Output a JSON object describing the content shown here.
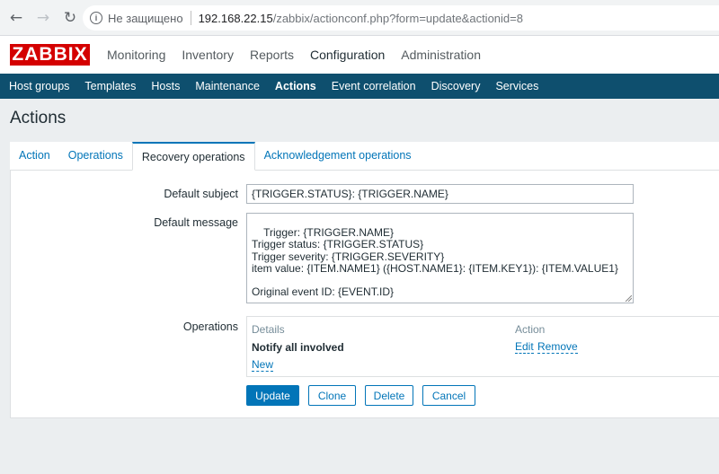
{
  "browser": {
    "back_icon": "←",
    "forward_icon": "→",
    "reload_icon": "↻",
    "info_icon": "i",
    "security_text": "Не защищено",
    "url_host": "192.168.22.15",
    "url_path": "/zabbix/actionconf.php?form=update&actionid=8"
  },
  "logo": "ZABBIX",
  "main_menu": [
    {
      "label": "Monitoring"
    },
    {
      "label": "Inventory"
    },
    {
      "label": "Reports"
    },
    {
      "label": "Configuration"
    },
    {
      "label": "Administration"
    }
  ],
  "sub_menu": [
    {
      "label": "Host groups"
    },
    {
      "label": "Templates"
    },
    {
      "label": "Hosts"
    },
    {
      "label": "Maintenance"
    },
    {
      "label": "Actions"
    },
    {
      "label": "Event correlation"
    },
    {
      "label": "Discovery"
    },
    {
      "label": "Services"
    }
  ],
  "page_title": "Actions",
  "tabs": [
    {
      "label": "Action"
    },
    {
      "label": "Operations"
    },
    {
      "label": "Recovery operations"
    },
    {
      "label": "Acknowledgement operations"
    }
  ],
  "form": {
    "subject_label": "Default subject",
    "subject_value": "{TRIGGER.STATUS}: {TRIGGER.NAME}",
    "message_label": "Default message",
    "message_value": "Trigger: {TRIGGER.NAME}\nTrigger status: {TRIGGER.STATUS}\nTrigger severity: {TRIGGER.SEVERITY}\nitem value: {ITEM.NAME1} ({HOST.NAME1}: {ITEM.KEY1}): {ITEM.VALUE1}\n\nOriginal event ID: {EVENT.ID}",
    "operations_label": "Operations",
    "operations": {
      "details_header": "Details",
      "action_header": "Action",
      "row_detail": "Notify all involved",
      "edit_link": "Edit",
      "remove_link": "Remove",
      "new_link": "New"
    }
  },
  "buttons": {
    "update": "Update",
    "clone": "Clone",
    "delete": "Delete",
    "cancel": "Cancel"
  },
  "colors": {
    "brand_red": "#d40000",
    "nav_blue": "#0e4f6e",
    "link_blue": "#0275b8"
  }
}
